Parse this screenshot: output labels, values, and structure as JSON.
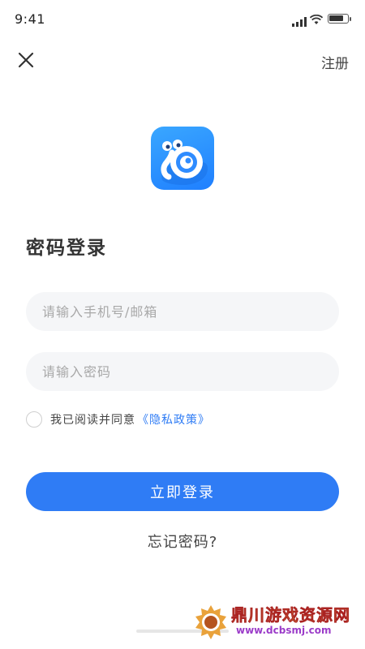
{
  "status_bar": {
    "time": "9:41",
    "icons": [
      "signal-icon",
      "wifi-icon",
      "battery-icon"
    ],
    "battery_level": 0.85
  },
  "header": {
    "close_icon": "close-icon",
    "register_label": "注册"
  },
  "logo": {
    "icon": "snail-logo-icon",
    "colors": {
      "background": "#2F8CFF",
      "shell": "#FFFFFF"
    }
  },
  "login": {
    "title": "密码登录",
    "account_placeholder": "请输入手机号/邮箱",
    "account_value": "",
    "password_placeholder": "请输入密码",
    "password_value": "",
    "agree_checked": false,
    "agree_text": "我已阅读并同意",
    "policy_link": "《隐私政策》",
    "submit_label": "立即登录",
    "forgot_label": "忘记密码?"
  },
  "watermark": {
    "title": "鼎川游戏资源网",
    "url": "www.dcbsmj.com"
  },
  "colors": {
    "accent": "#2F7CF5",
    "input_bg": "#F5F6F8",
    "text": "#333333",
    "placeholder": "#A8A8A8"
  }
}
